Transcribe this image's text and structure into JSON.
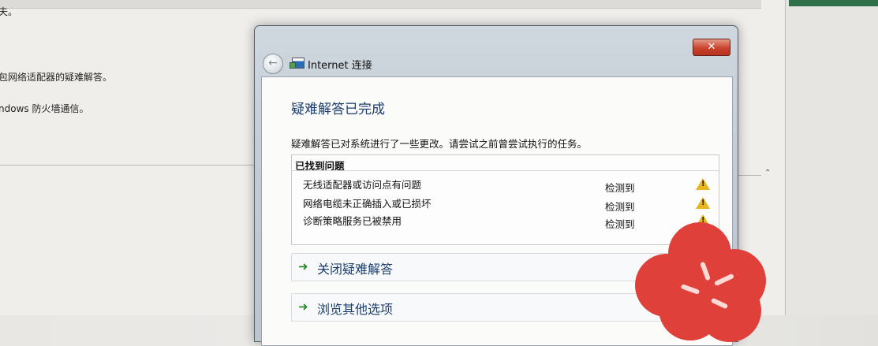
{
  "background_window": {
    "line1": "夫。",
    "line2": "包网络适配器的疑难解答。",
    "line3": "ndows 防火墙通信。"
  },
  "dialog": {
    "title": "Internet 连接",
    "close_label": "✕",
    "back_icon": "back-arrow-icon",
    "heading": "疑难解答已完成",
    "description": "疑难解答已对系统进行了一些更改。请尝试之前曾尝试执行的任务。",
    "issues": {
      "header": "已找到问题",
      "items": [
        {
          "name": "无线适配器或访问点有问题",
          "status": "检测到",
          "icon": "warning-icon"
        },
        {
          "name": "网络电缆未正确插入或已损坏",
          "status": "检测到",
          "icon": "warning-icon"
        },
        {
          "name": "诊断策略服务已被禁用",
          "status": "检测到",
          "icon": "warning-icon"
        }
      ]
    },
    "actions": [
      {
        "label": "关闭疑难解答",
        "icon": "green-arrow-icon"
      },
      {
        "label": "浏览其他选项",
        "icon": "green-arrow-icon"
      }
    ]
  },
  "colors": {
    "heading": "#1b3d6e",
    "warning": "#e7b51e",
    "close_button": "#c9432d",
    "sticker": "#e0403a"
  }
}
